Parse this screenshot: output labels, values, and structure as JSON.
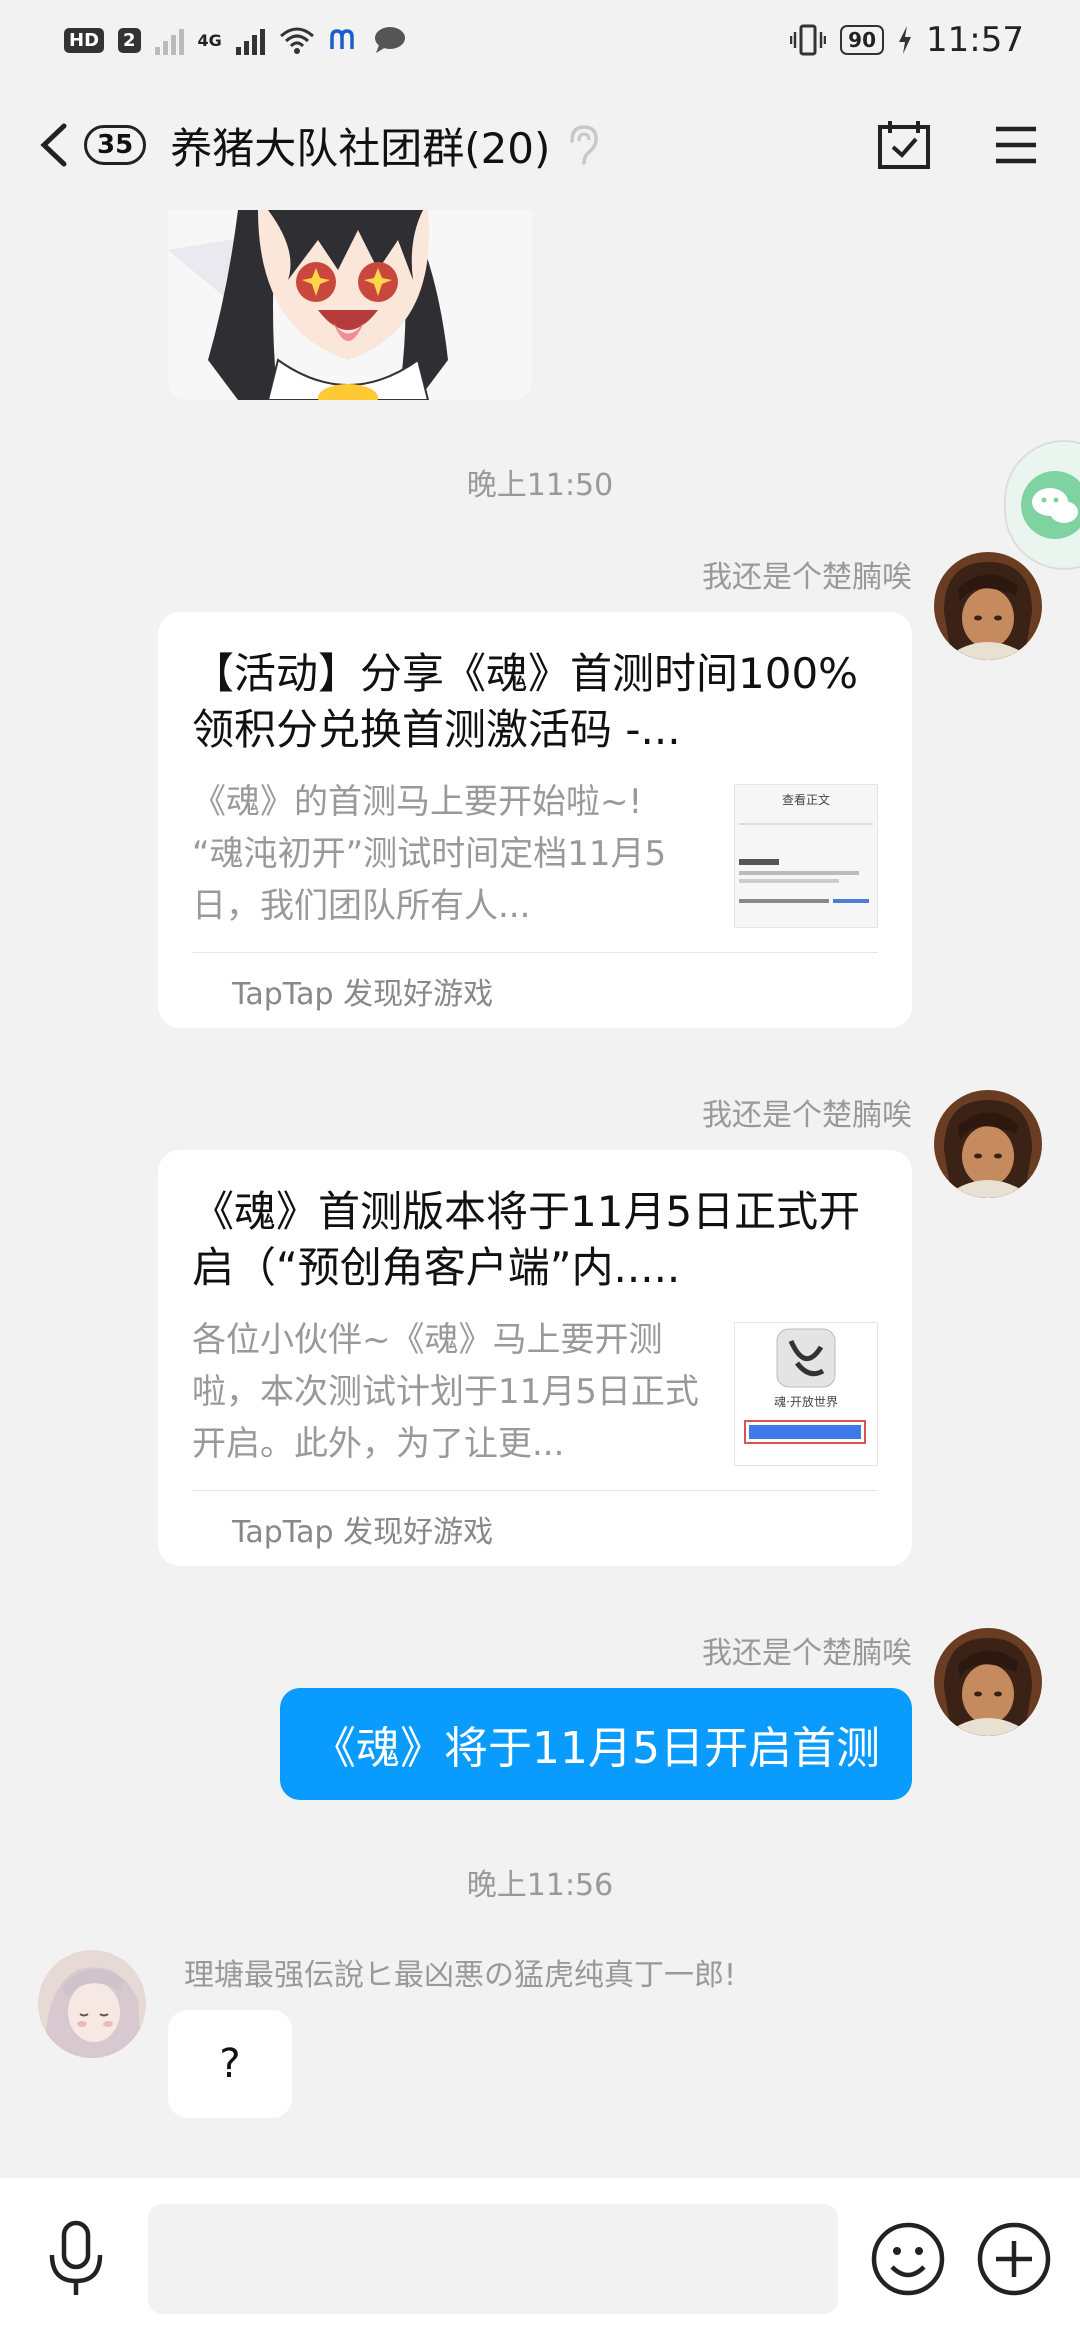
{
  "status_bar": {
    "hd_label": "HD",
    "sim_label": "2",
    "network_label": "4G",
    "battery": "90",
    "time": "11:57"
  },
  "header": {
    "unread_count": "35",
    "title": "养猪大队社团群(20)"
  },
  "messages": [
    {
      "type": "timestamp",
      "text": "晚上11:50"
    },
    {
      "type": "card",
      "sender": "我还是个楚腩唉",
      "title": "【活动】分享《魂》首测时间100%领积分兑换首测激活码 -...",
      "desc": "《魂》的首测马上要开始啦~! “魂沌初开”测试时间定档11月5日，我们团队所有人...",
      "thumb_text": "查看正文",
      "source": "TapTap 发现好游戏"
    },
    {
      "type": "card",
      "sender": "我还是个楚腩唉",
      "title": "《魂》首测版本将于11月5日正式开启（“预创角客户端”内.....",
      "desc": "各位小伙伴~《魂》马上要开测啦，本次测试计划于11月5日正式开启。此外，为了让更...",
      "thumb_text": "魂·开放世界",
      "source": "TapTap 发现好游戏"
    },
    {
      "type": "text",
      "sender": "我还是个楚腩唉",
      "text": "《魂》将于11月5日开启首测"
    },
    {
      "type": "timestamp",
      "text": "晚上11:56"
    },
    {
      "type": "text",
      "sender": "理塘最强伝說ヒ最凶悪の猛虎纯真丁一郎!",
      "text": "?"
    }
  ],
  "input": {
    "placeholder": ""
  },
  "colors": {
    "accent": "#0a9bff",
    "background": "#f2f2f2"
  }
}
